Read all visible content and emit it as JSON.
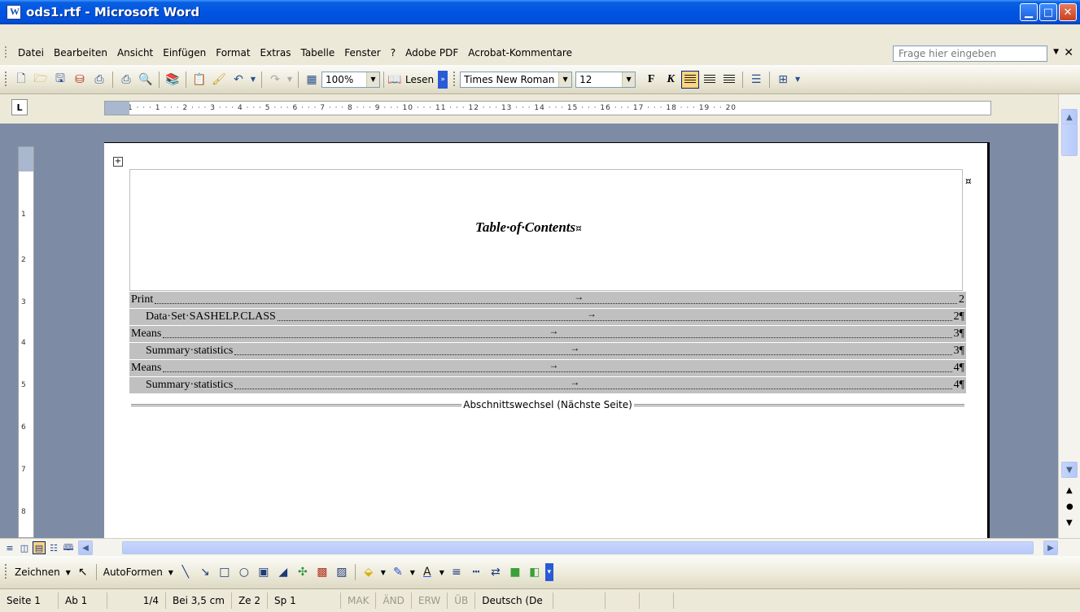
{
  "window": {
    "title": "ods1.rtf - Microsoft Word"
  },
  "menu": {
    "items": [
      "Datei",
      "Bearbeiten",
      "Ansicht",
      "Einfügen",
      "Format",
      "Extras",
      "Tabelle",
      "Fenster",
      "?",
      "Adobe PDF",
      "Acrobat-Kommentare"
    ],
    "help_placeholder": "Frage hier eingeben"
  },
  "toolbar": {
    "zoom": "100%",
    "read_label": "Lesen",
    "font_name": "Times New Roman",
    "font_size": "12",
    "bold_label": "F",
    "italic_label": "K"
  },
  "ruler": {
    "text": "1 · · · 1 · · · 2 · · · 3 · · · 4 · · · 5 · · · 6 · · · 7 · · · 8 · · · 9 · · · 10 · · · 11 · · · 12 · · · 13 · · · 14 · · · 15 · · · 16 · · · 17 · · · 18 · · · 19 · · 20",
    "vertical": [
      "1",
      "2",
      "3",
      "4",
      "5",
      "6",
      "7",
      "8"
    ]
  },
  "document": {
    "title": "Table·of·Contents",
    "cell_mark": "¤",
    "toc": [
      {
        "text": "Print",
        "page": "2",
        "indent": false
      },
      {
        "text": "Data·Set·SASHELP.CLASS",
        "page": "2¶",
        "indent": true
      },
      {
        "text": "Means",
        "page": "3¶",
        "indent": false
      },
      {
        "text": "Summary·statistics",
        "page": "3¶",
        "indent": true
      },
      {
        "text": "Means",
        "page": "4¶",
        "indent": false
      },
      {
        "text": "Summary·statistics",
        "page": "4¶",
        "indent": true
      }
    ],
    "section_break": "Abschnittswechsel (Nächste Seite)"
  },
  "drawing": {
    "draw_label": "Zeichnen",
    "autoshapes_label": "AutoFormen"
  },
  "status": {
    "page": "Seite 1",
    "section": "Ab 1",
    "pages": "1/4",
    "position": "Bei 3,5 cm",
    "line": "Ze 2",
    "column": "Sp 1",
    "mak": "MAK",
    "and": "ÄND",
    "erw": "ERW",
    "ub": "ÜB",
    "language": "Deutsch (De"
  }
}
